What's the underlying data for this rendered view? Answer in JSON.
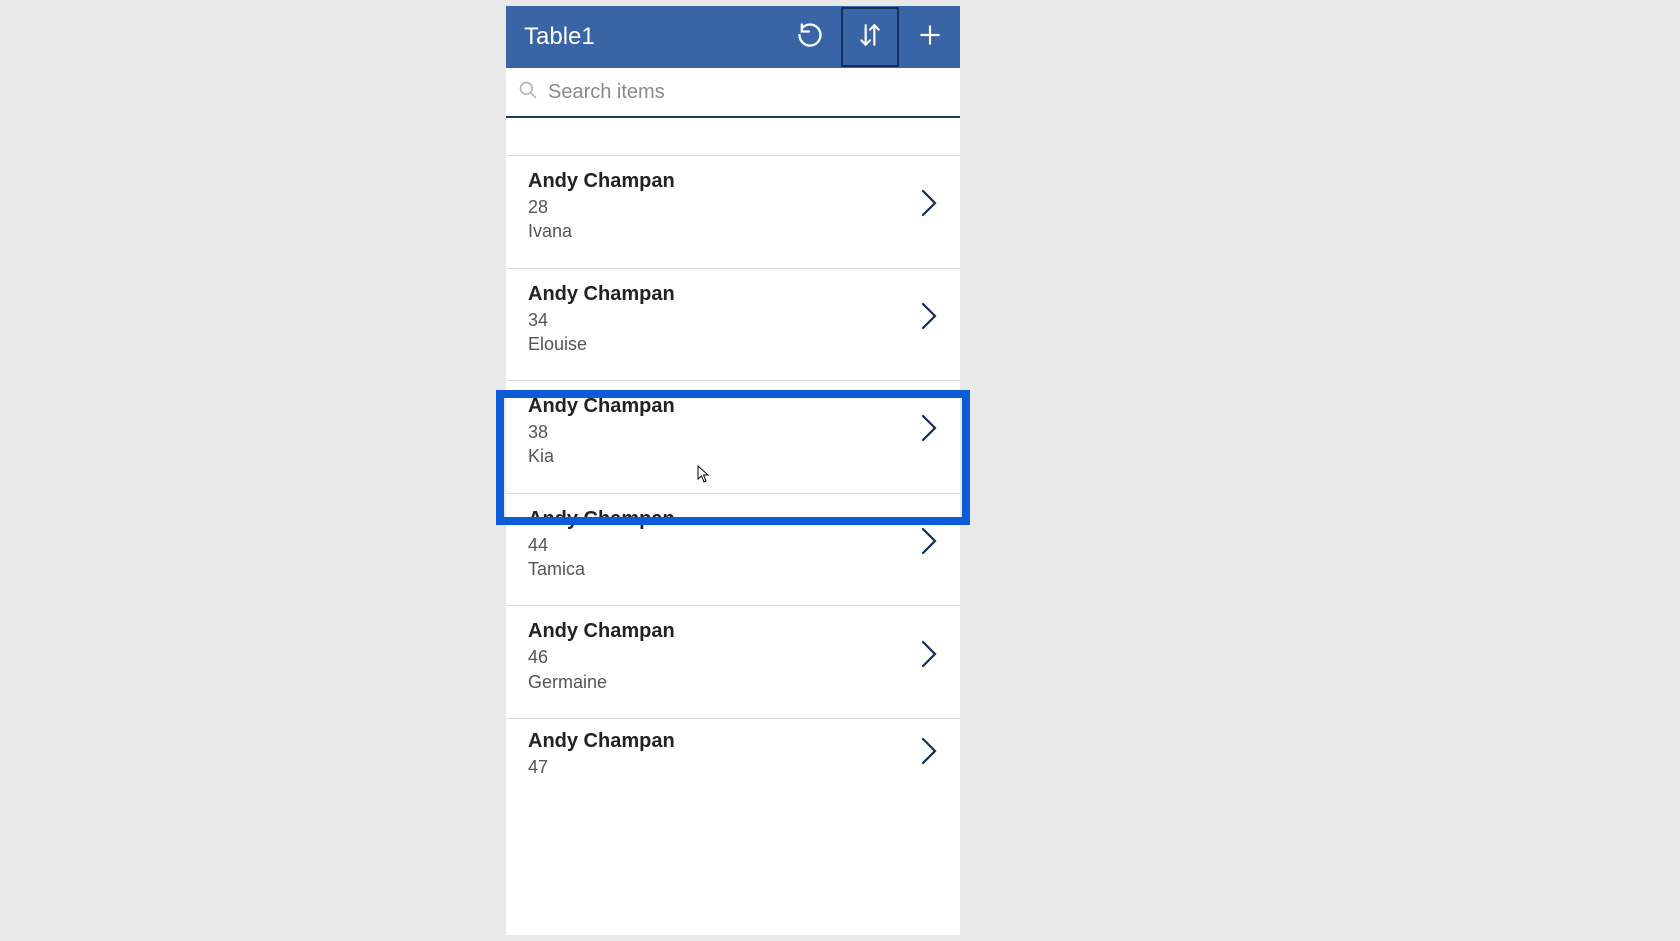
{
  "header": {
    "title": "Table1",
    "buttons": {
      "refresh": "refresh",
      "sort": "sort",
      "add": "add"
    },
    "sort_selected": true
  },
  "search": {
    "placeholder": "Search items",
    "value": ""
  },
  "highlighted_index": 2,
  "items": [
    {
      "name": "Andy Champan",
      "value": "28",
      "sub": "Ivana"
    },
    {
      "name": "Andy Champan",
      "value": "34",
      "sub": "Elouise"
    },
    {
      "name": "Andy Champan",
      "value": "38",
      "sub": "Kia"
    },
    {
      "name": "Andy Champan",
      "value": "44",
      "sub": "Tamica"
    },
    {
      "name": "Andy Champan",
      "value": "46",
      "sub": "Germaine"
    },
    {
      "name": "Andy Champan",
      "value": "47",
      "sub": ""
    }
  ],
  "colors": {
    "header_bg": "#3965a7",
    "accent": "#0b5cd6",
    "chevron": "#152f5c"
  }
}
